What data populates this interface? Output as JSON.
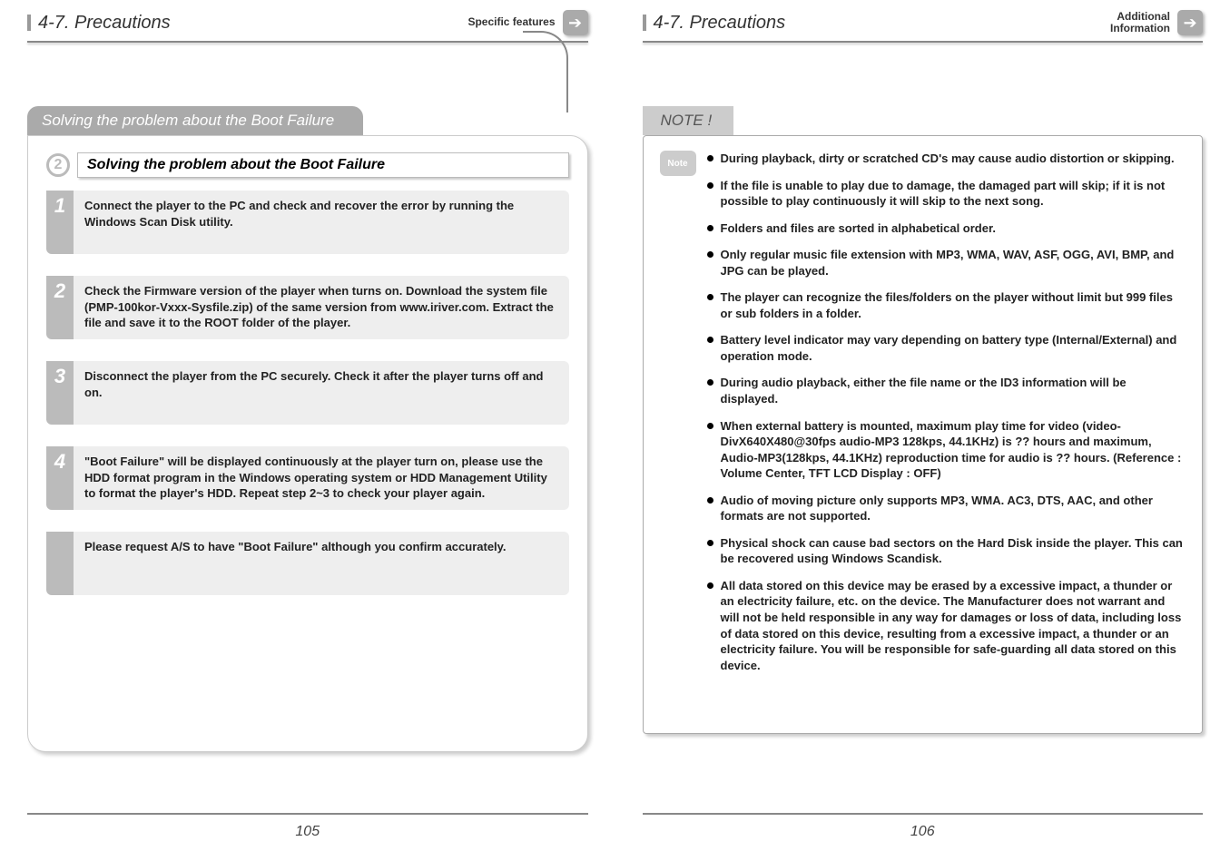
{
  "left": {
    "headerTitle": "4-7. Precautions",
    "headerCategory": "Specific features",
    "sectionTab": "Solving the problem about the Boot Failure",
    "circleNum": "2",
    "subheaderTitle": "Solving the problem about the Boot Failure",
    "steps": [
      {
        "num": "1",
        "text": "Connect the player to the PC and check and recover the error by running the Windows Scan Disk utility."
      },
      {
        "num": "2",
        "text": "Check the Firmware version of the player when turns on. Download the system file (PMP-100kor-Vxxx-Sysfile.zip) of the same version from www.iriver.com. Extract the file and save it to the ROOT folder of the player."
      },
      {
        "num": "3",
        "text": "Disconnect the player from the PC securely. Check it after the player turns off and on."
      },
      {
        "num": "4",
        "text": "\"Boot Failure\" will be displayed continuously at the player turn on, please use the HDD format program in the Windows operating system or HDD Management Utility to format the player's HDD. Repeat step 2~3 to check your player again."
      },
      {
        "num": "",
        "text": "Please request A/S to have \"Boot Failure\" although you confirm accurately."
      }
    ],
    "pageNum": "105"
  },
  "right": {
    "headerTitle": "4-7. Precautions",
    "headerCategoryLine1": "Additional",
    "headerCategoryLine2": "Information",
    "sectionTab": "NOTE !",
    "notes": [
      "During playback, dirty or scratched CD's may cause audio distortion or skipping.",
      "If the file is unable to play due to damage, the damaged part will skip; if it is not possible to play continuously it will skip to the next song.",
      "Folders and files are sorted in alphabetical order.",
      "Only regular music file extension with MP3, WMA, WAV, ASF, OGG, AVI, BMP, and JPG can be played.",
      "The player can recognize the files/folders on the player without limit but 999 files or sub folders in a folder.",
      "Battery level indicator may vary depending on battery type (Internal/External) and operation mode.",
      "During audio playback, either the file name or the ID3 information will be displayed.",
      "When external battery is mounted, maximum play time for video (video-DivX640X480@30fps audio-MP3 128kps, 44.1KHz) is ?? hours and maximum, Audio-MP3(128kps, 44.1KHz) reproduction time for audio is ?? hours. (Reference : Volume Center, TFT LCD Display : OFF)",
      "Audio of moving picture only supports MP3, WMA. AC3, DTS, AAC, and other formats are not supported.",
      "Physical shock can cause bad sectors on the Hard Disk inside the player. This can be recovered using Windows Scandisk.",
      "All data stored on this device may be erased by a excessive impact, a thunder or an electricity failure, etc. on the device. The Manufacturer does not warrant and will not be held responsible in any way for damages or loss of data, including loss of data stored on this device, resulting from a excessive impact, a thunder or an electricity failure. You will be responsible for safe-guarding all data stored on this device."
    ],
    "pageNum": "106"
  }
}
